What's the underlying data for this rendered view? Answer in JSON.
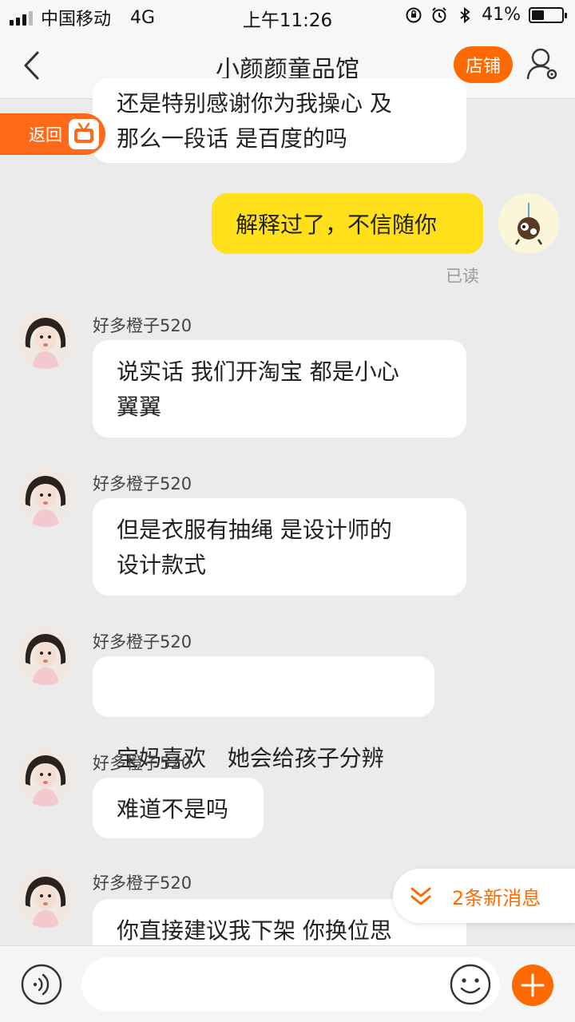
{
  "status_bar": {
    "carrier": "中国移动",
    "network": "4G",
    "time": "上午11:26",
    "battery_text": "41%",
    "battery_level": 0.41
  },
  "nav": {
    "title": "小颜颜童品馆",
    "shop_label": "店铺"
  },
  "return_pill": {
    "label": "返回"
  },
  "messages": [
    {
      "from": "other",
      "text_lines": [
        "还是特别感谢你为我操心 及",
        "那么一段话 是百度的吗"
      ]
    },
    {
      "from": "me",
      "text_lines": [
        "解释过了，不信随你"
      ],
      "status": "已读"
    },
    {
      "from": "other",
      "nick": "好多橙子520",
      "text_lines": [
        "说实话 我们开淘宝 都是小心",
        "翼翼"
      ]
    },
    {
      "from": "other",
      "nick": "好多橙子520",
      "text_lines": [
        "但是衣服有抽绳 是设计师的",
        "设计款式"
      ]
    },
    {
      "from": "other",
      "nick": "好多橙子520",
      "text_lines": [
        "宝妈喜欢   她会给孩子分辨"
      ]
    },
    {
      "from": "other",
      "nick": "好多橙子520",
      "text_lines": [
        "难道不是吗"
      ]
    },
    {
      "from": "other",
      "nick": "好多橙子520",
      "text_lines": [
        "你直接建议我下架 你换位思"
      ]
    }
  ],
  "new_messages": {
    "label": "2条新消息"
  },
  "input": {
    "value": "",
    "placeholder": ""
  },
  "colors": {
    "accent": "#ff6a00",
    "my_bubble": "#ffe01a",
    "background": "#ebebeb"
  },
  "icons": [
    "back-arrow-icon",
    "person-settings-icon",
    "tv-icon",
    "voice-icon",
    "emoji-icon",
    "plus-icon",
    "chevron-down-double-icon"
  ]
}
